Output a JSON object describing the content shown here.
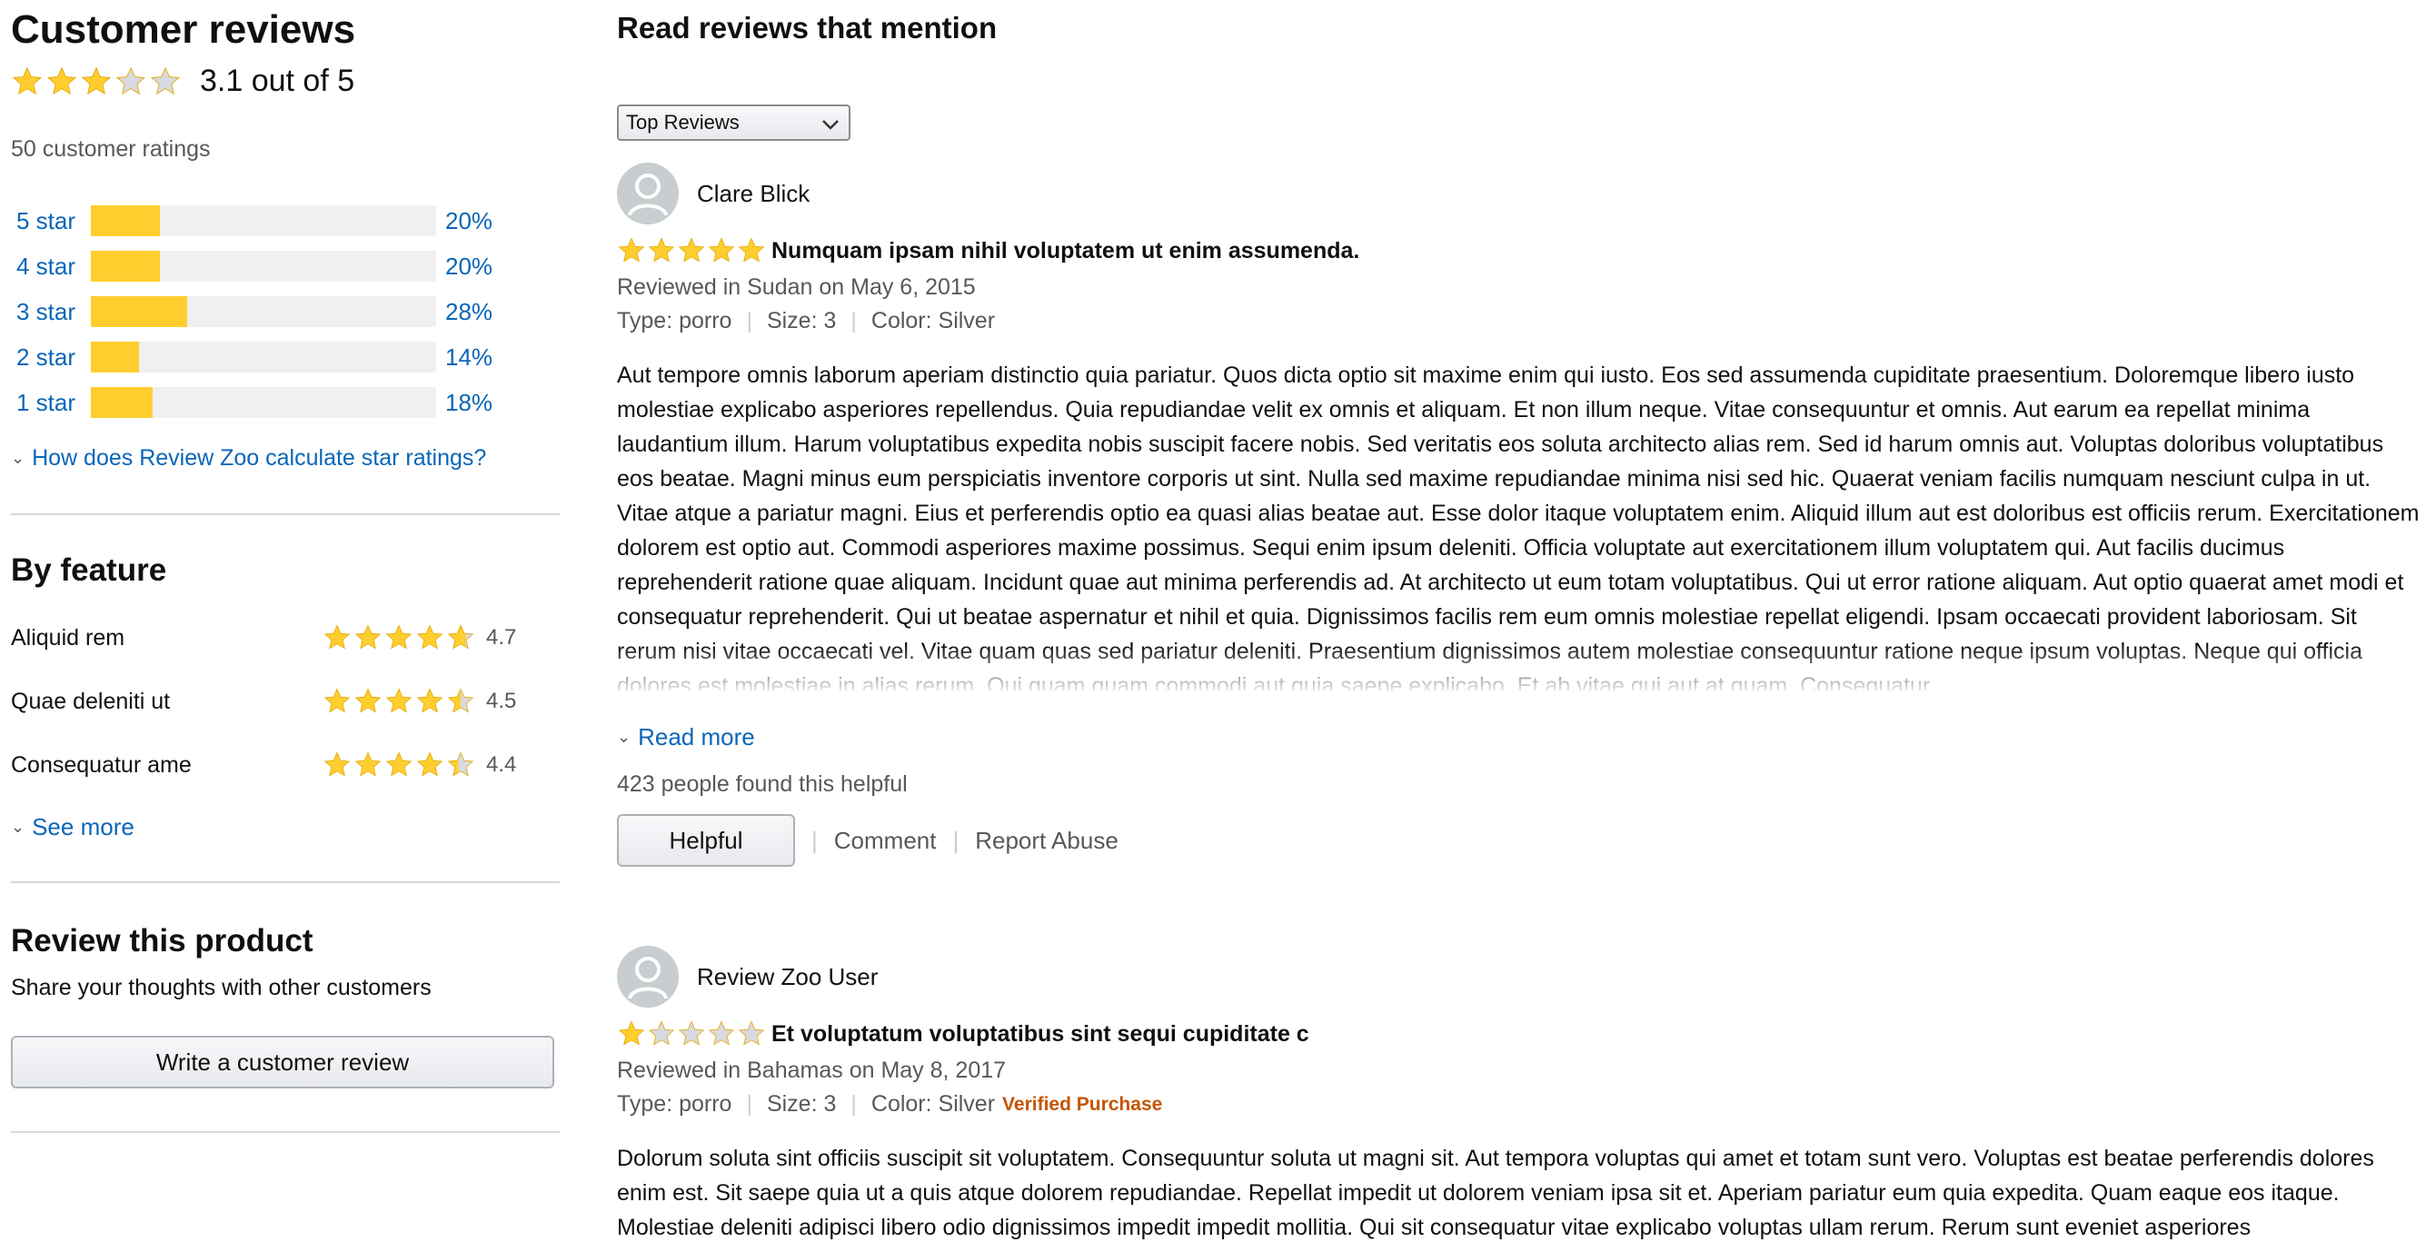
{
  "summary": {
    "title": "Customer reviews",
    "rating": 3.1,
    "rating_text": "3.1 out of 5",
    "total_ratings": "50 customer ratings",
    "histogram": [
      {
        "label": "5 star",
        "percent": 20,
        "percent_text": "20%"
      },
      {
        "label": "4 star",
        "percent": 20,
        "percent_text": "20%"
      },
      {
        "label": "3 star",
        "percent": 28,
        "percent_text": "28%"
      },
      {
        "label": "2 star",
        "percent": 14,
        "percent_text": "14%"
      },
      {
        "label": "1 star",
        "percent": 18,
        "percent_text": "18%"
      }
    ],
    "calc_link": "How does Review Zoo calculate star ratings?"
  },
  "features": {
    "title": "By feature",
    "items": [
      {
        "name": "Aliquid rem",
        "rating": 4.7,
        "score": "4.7"
      },
      {
        "name": "Quae deleniti ut",
        "rating": 4.5,
        "score": "4.5"
      },
      {
        "name": "Consequatur ame",
        "rating": 4.4,
        "score": "4.4"
      }
    ],
    "see_more": "See more"
  },
  "review_product": {
    "title": "Review this product",
    "subtitle": "Share your thoughts with other customers",
    "button": "Write a customer review"
  },
  "reviews_header": {
    "title": "Read reviews that mention",
    "sort_selected": "Top Reviews"
  },
  "reviews": [
    {
      "author": "Clare Blick",
      "stars": 5,
      "title": "Numquam ipsam nihil voluptatem ut enim assumenda.",
      "reviewed": "Reviewed in Sudan on May 6, 2015",
      "type": "Type: porro",
      "size": "Size: 3",
      "color": "Color: Silver",
      "verified": "",
      "body": "Aut tempore omnis laborum aperiam distinctio quia pariatur. Quos dicta optio sit maxime enim qui iusto. Eos sed assumenda cupiditate praesentium. Doloremque libero iusto molestiae explicabo asperiores repellendus. Quia repudiandae velit ex omnis et aliquam. Et non illum neque. Vitae consequuntur et omnis. Aut earum ea repellat minima laudantium illum. Harum voluptatibus expedita nobis suscipit facere nobis. Sed veritatis eos soluta architecto alias rem. Sed id harum omnis aut. Voluptas doloribus voluptatibus eos beatae. Magni minus eum perspiciatis inventore corporis ut sint. Nulla sed maxime repudiandae minima nisi sed hic. Quaerat veniam facilis numquam nesciunt culpa in ut. Vitae atque a pariatur magni. Eius et perferendis optio ea quasi alias beatae aut. Esse dolor itaque voluptatem enim. Aliquid illum aut est doloribus est officiis rerum. Exercitationem dolorem est optio aut. Commodi asperiores maxime possimus. Sequi enim ipsum deleniti. Officia voluptate aut exercitationem illum voluptatem qui. Aut facilis ducimus reprehenderit ratione quae aliquam. Incidunt quae aut minima perferendis ad. At architecto ut eum totam voluptatibus. Qui ut error ratione aliquam. Aut optio quaerat amet modi et consequatur reprehenderit. Qui ut beatae aspernatur et nihil et quia. Dignissimos facilis rem eum omnis molestiae repellat eligendi. Ipsam occaecati provident laboriosam. Sit rerum nisi vitae occaecati vel. Vitae quam quas sed pariatur deleniti. Praesentium dignissimos autem molestiae consequuntur ratione neque ipsum voluptas. Neque qui officia dolores est molestiae in alias rerum. Qui quam quam commodi aut quia saepe explicabo. Et ab vitae qui aut at quam. Consequatur",
      "read_more": "Read more",
      "helpful_count": "423 people found this helpful",
      "helpful_button": "Helpful",
      "comment": "Comment",
      "report": "Report Abuse"
    },
    {
      "author": "Review Zoo User",
      "stars": 1,
      "title": "Et voluptatum voluptatibus sint sequi cupiditate c",
      "reviewed": "Reviewed in Bahamas on May 8, 2017",
      "type": "Type: porro",
      "size": "Size: 3",
      "color": "Color: Silver",
      "verified": "Verified Purchase",
      "body": "Dolorum soluta sint officiis suscipit sit voluptatem. Consequuntur soluta ut magni sit. Aut tempora voluptas qui amet et totam sunt vero. Voluptas est beatae perferendis dolores enim est. Sit saepe quia ut a quis atque dolorem repudiandae. Repellat impedit ut dolorem veniam ipsa sit et. Aperiam pariatur eum quia expedita. Quam eaque eos itaque. Molestiae deleniti adipisci libero odio dignissimos impedit impedit mollitia. Qui sit consequatur vitae explicabo voluptas ullam rerum. Rerum sunt eveniet asperiores"
    }
  ],
  "colors": {
    "star_fill": "#ffce2e",
    "star_empty": "#d7dae0",
    "link": "#0a66b8",
    "verified": "#c45500",
    "bar_bg": "#f0f0f0"
  }
}
